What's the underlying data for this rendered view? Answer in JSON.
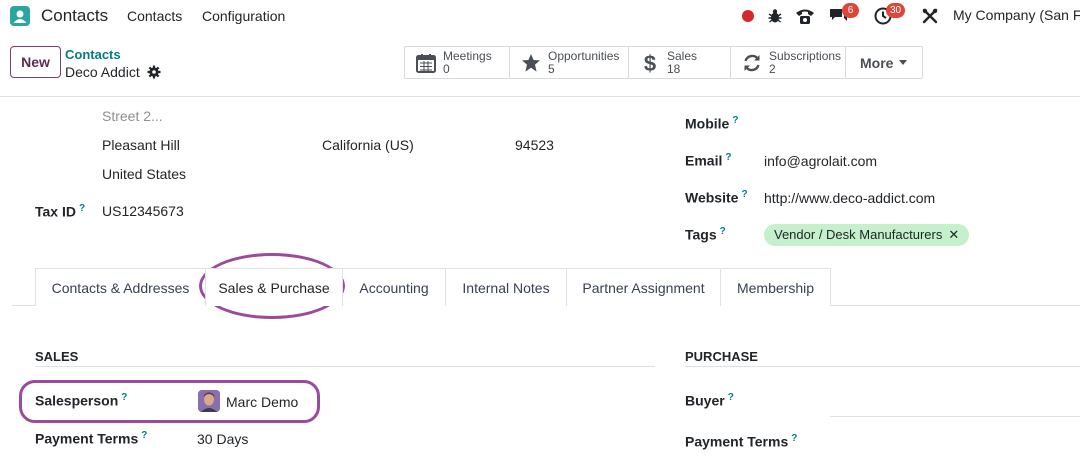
{
  "navbar": {
    "app_name": "Contacts",
    "menu": [
      "Contacts",
      "Configuration"
    ],
    "chat_badge": "6",
    "activity_badge": "30",
    "company": "My Company (San Fr"
  },
  "control_panel": {
    "new_label": "New",
    "breadcrumb_parent": "Contacts",
    "breadcrumb_current": "Deco Addict",
    "smart_buttons": [
      {
        "label": "Meetings",
        "value": "0",
        "icon": "calendar-icon"
      },
      {
        "label": "Opportunities",
        "value": "5",
        "icon": "star-icon"
      },
      {
        "label": "Sales",
        "value": "18",
        "icon": "dollar-icon"
      },
      {
        "label": "Subscriptions",
        "value": "2",
        "icon": "refresh-icon"
      }
    ],
    "more_label": "More"
  },
  "address": {
    "street2_placeholder": "Street 2...",
    "city": "Pleasant Hill",
    "state": "California (US)",
    "zip": "94523",
    "country": "United States"
  },
  "tax_id": {
    "label": "Tax ID",
    "value": "US12345673"
  },
  "contact": {
    "mobile_label": "Mobile",
    "email_label": "Email",
    "email_value": "info@agrolait.com",
    "website_label": "Website",
    "website_value": "http://www.deco-addict.com",
    "tags_label": "Tags",
    "tag": "Vendor / Desk Manufacturers"
  },
  "tabs": [
    "Contacts & Addresses",
    "Sales & Purchase",
    "Accounting",
    "Internal Notes",
    "Partner Assignment",
    "Membership"
  ],
  "sales": {
    "title": "SALES",
    "salesperson_label": "Salesperson",
    "salesperson_value": "Marc Demo",
    "payment_terms_label": "Payment Terms",
    "payment_terms_value": "30 Days"
  },
  "purchase": {
    "title": "PURCHASE",
    "buyer_label": "Buyer",
    "payment_terms_label": "Payment Terms"
  },
  "colors": {
    "brand": "#714b67",
    "link": "#017e84",
    "badge": "#e0453a",
    "tag_bg": "#c6f0cb",
    "annotation": "#9c4a9b"
  }
}
